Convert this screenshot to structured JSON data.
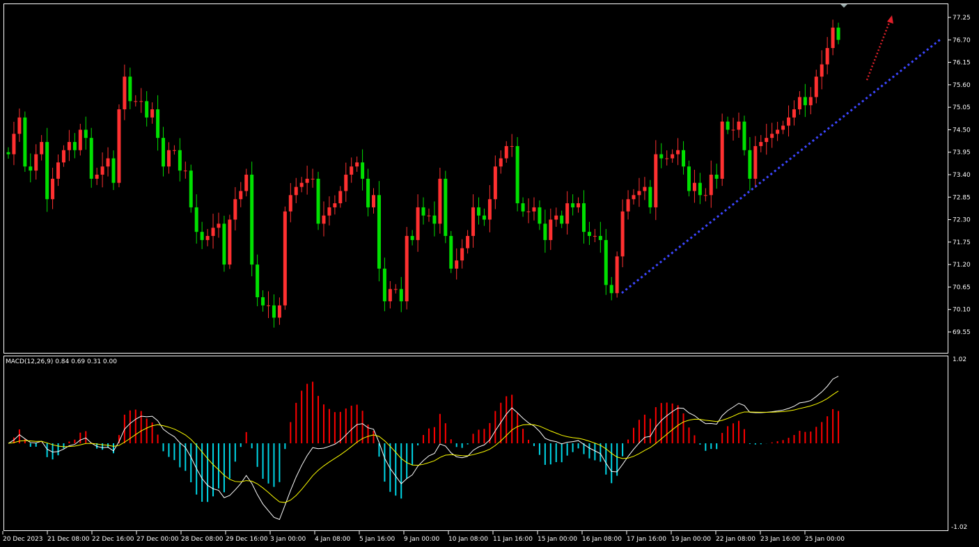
{
  "chart_data": {
    "type": "candlestick",
    "price_axis": {
      "ticks": [
        "77.25",
        "76.70",
        "76.15",
        "75.60",
        "75.05",
        "74.50",
        "73.95",
        "73.40",
        "72.85",
        "72.30",
        "71.75",
        "71.20",
        "70.65",
        "70.10",
        "69.55"
      ],
      "range": [
        69.3,
        77.45
      ]
    },
    "time_axis": {
      "ticks": [
        "20 Dec 2023",
        "21 Dec 08:00",
        "22 Dec 16:00",
        "27 Dec 00:00",
        "28 Dec 08:00",
        "29 Dec 16:00",
        "3 Jan 00:00",
        "4 Jan 08:00",
        "5 Jan 16:00",
        "9 Jan 00:00",
        "10 Jan 08:00",
        "11 Jan 16:00",
        "15 Jan 00:00",
        "16 Jan 08:00",
        "17 Jan 16:00",
        "19 Jan 00:00",
        "22 Jan 08:00",
        "23 Jan 16:00",
        "25 Jan 00:00"
      ]
    },
    "closes": [
      73.9,
      74.4,
      74.8,
      73.6,
      73.5,
      73.9,
      74.2,
      72.8,
      73.3,
      73.7,
      74.0,
      74.2,
      74.0,
      74.5,
      74.3,
      73.3,
      73.4,
      73.6,
      73.8,
      73.2,
      75.0,
      75.8,
      75.2,
      75.2,
      75.2,
      74.8,
      75.0,
      74.3,
      73.6,
      74.0,
      74.0,
      73.5,
      73.5,
      72.6,
      72.0,
      71.8,
      71.9,
      72.1,
      72.2,
      71.2,
      72.3,
      72.8,
      73.0,
      73.4,
      71.2,
      70.4,
      70.2,
      70.2,
      69.9,
      70.2,
      72.5,
      72.9,
      73.1,
      73.2,
      73.3,
      73.3,
      72.2,
      72.4,
      72.6,
      72.7,
      73.0,
      73.4,
      73.6,
      73.7,
      73.3,
      72.6,
      72.9,
      71.1,
      70.3,
      70.6,
      70.6,
      70.3,
      71.9,
      71.8,
      72.6,
      72.4,
      72.4,
      72.2,
      73.3,
      71.9,
      71.1,
      71.3,
      71.6,
      71.9,
      72.6,
      72.4,
      72.3,
      72.8,
      73.6,
      73.8,
      74.1,
      74.1,
      72.7,
      72.5,
      72.5,
      72.6,
      72.2,
      71.8,
      72.3,
      72.4,
      72.2,
      72.7,
      72.6,
      72.7,
      72.0,
      71.9,
      71.9,
      71.8,
      70.7,
      70.5,
      71.4,
      72.5,
      72.8,
      72.9,
      73.0,
      73.1,
      72.6,
      73.9,
      73.8,
      73.8,
      73.9,
      74.0,
      73.6,
      73.0,
      73.2,
      72.9,
      72.9,
      73.4,
      73.3,
      74.7,
      74.5,
      74.5,
      74.7,
      74.0,
      73.3,
      74.1,
      74.2,
      74.3,
      74.4,
      74.5,
      74.6,
      74.8,
      75.0,
      75.3,
      75.1,
      75.3,
      75.8,
      76.1,
      76.5,
      77.0,
      76.7
    ],
    "open_first": 73.95,
    "up_color": "#ff3030",
    "down_color": "#00e000",
    "indicator": {
      "label": "MACD(12,26,9) 0.84 0.69 0.31 0.00",
      "params": [
        12,
        26,
        9
      ],
      "axis_ticks": [
        "1.02",
        "-1.02"
      ],
      "range": [
        -1.02,
        1.02
      ],
      "hist_pos_color": "#ff0000",
      "hist_neg_color": "#00d8e8",
      "macd_color": "#ffffff",
      "signal_color": "#ffff00"
    },
    "annotations": [
      {
        "type": "trendline",
        "color": "#3c46ff",
        "from_price": 70.45,
        "to_price": 76.7
      },
      {
        "type": "arrow",
        "color": "#e0202a"
      }
    ]
  }
}
